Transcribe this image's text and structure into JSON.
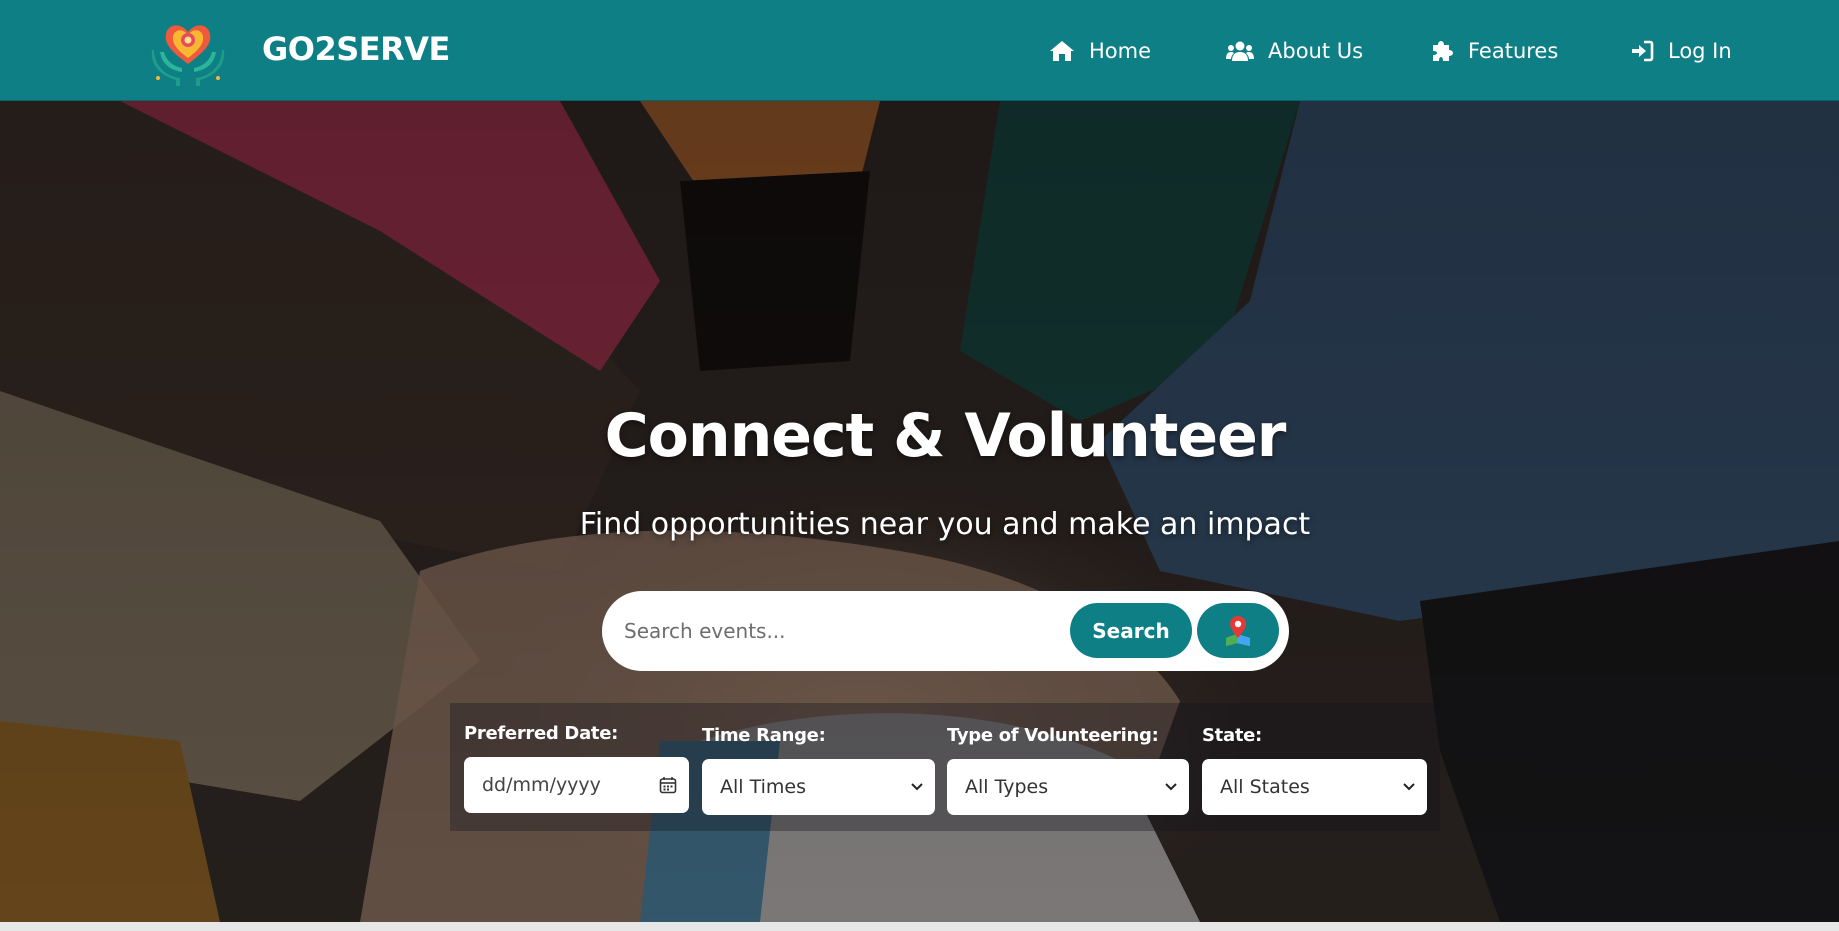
{
  "navbar": {
    "brand": "GO2SERVE",
    "logo_icon": "heart-hands-logo",
    "items": [
      {
        "label": "Home",
        "icon": "home-icon"
      },
      {
        "label": "About Us",
        "icon": "users-icon"
      },
      {
        "label": "Features",
        "icon": "puzzle-icon"
      },
      {
        "label": "Log In",
        "icon": "sign-in-icon"
      }
    ]
  },
  "hero": {
    "title": "Connect & Volunteer",
    "subtitle": "Find opportunities near you and make an impact"
  },
  "search": {
    "placeholder": "Search events...",
    "button_label": "Search",
    "map_icon": "map-pin-icon"
  },
  "filters": {
    "date": {
      "label": "Preferred Date:",
      "value": "dd/mm/yyyy",
      "icon": "calendar-icon"
    },
    "time": {
      "label": "Time Range:",
      "value": "All Times"
    },
    "type": {
      "label": "Type of Volunteering:",
      "value": "All Types"
    },
    "state": {
      "label": "State:",
      "value": "All States"
    }
  },
  "colors": {
    "teal": "#0f7f86",
    "white": "#ffffff"
  }
}
